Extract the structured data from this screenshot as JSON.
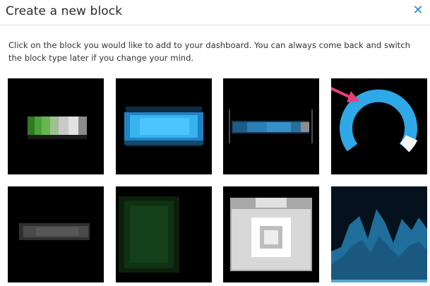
{
  "dialog": {
    "title": "Create a new block",
    "close_icon": "close-icon",
    "description": "Click on the block you would like to add to your dashboard. You can always come back and switch the block type later if you change your mind."
  },
  "blocks": [
    {
      "name": "progress-bar-green",
      "icon": "block-progress-icon"
    },
    {
      "name": "progress-bar-blue",
      "icon": "block-bar-icon"
    },
    {
      "name": "slider-blue",
      "icon": "block-slider-icon"
    },
    {
      "name": "gauge",
      "icon": "block-gauge-icon"
    },
    {
      "name": "bar-gray",
      "icon": "block-text-icon"
    },
    {
      "name": "panel-green",
      "icon": "block-panel-icon"
    },
    {
      "name": "camera",
      "icon": "block-image-icon"
    },
    {
      "name": "line-chart",
      "icon": "block-chart-icon"
    }
  ],
  "colors": {
    "accent": "#2f86c9",
    "gauge_blue": "#2ea8e6",
    "arrow_pink": "#e83e7a",
    "tile_bg": "#000000"
  }
}
